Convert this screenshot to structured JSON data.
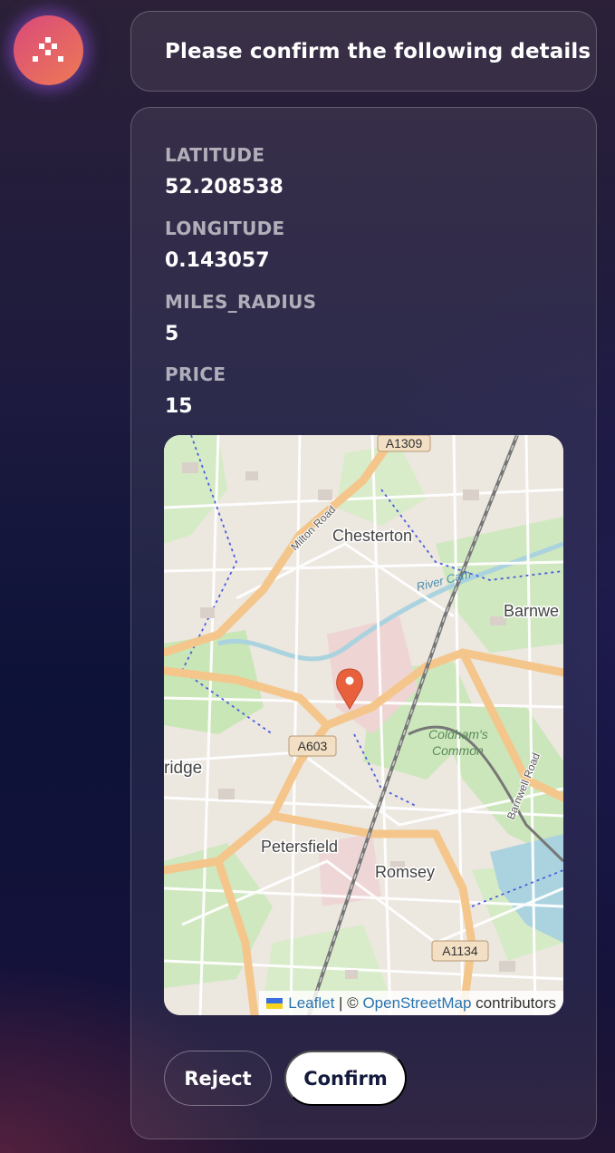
{
  "header": {
    "message": "Please confirm the following details"
  },
  "details": {
    "fields": [
      {
        "label": "LATITUDE",
        "value": "52.208538"
      },
      {
        "label": "LONGITUDE",
        "value": "0.143057"
      },
      {
        "label": "MILES_RADIUS",
        "value": "5"
      },
      {
        "label": "PRICE",
        "value": "15"
      }
    ]
  },
  "map": {
    "place_labels": {
      "chesterton": "Chesterton",
      "barnwell": "Barnwe",
      "cambridge": "ridge",
      "petersfield": "Petersfield",
      "romsey": "Romsey",
      "coldhams": "Coldham's",
      "common": "Common",
      "river": "River Cam",
      "milton_road": "Milton Road",
      "barnwell_road": "Barnwell Road"
    },
    "road_shields": {
      "a1309": "A1309",
      "a603": "A603",
      "a1134": "A1134"
    },
    "attribution": {
      "leaflet": "Leaflet",
      "separator": " | © ",
      "osm": "OpenStreetMap",
      "contributors": " contributors"
    },
    "marker_icon": "map-pin-icon",
    "marker_color": "#e8603c"
  },
  "actions": {
    "reject_label": "Reject",
    "confirm_label": "Confirm"
  },
  "avatar": {
    "icon": "assistant-logo-icon",
    "gradient_from": "#d9497a",
    "gradient_to": "#ee7a55"
  }
}
